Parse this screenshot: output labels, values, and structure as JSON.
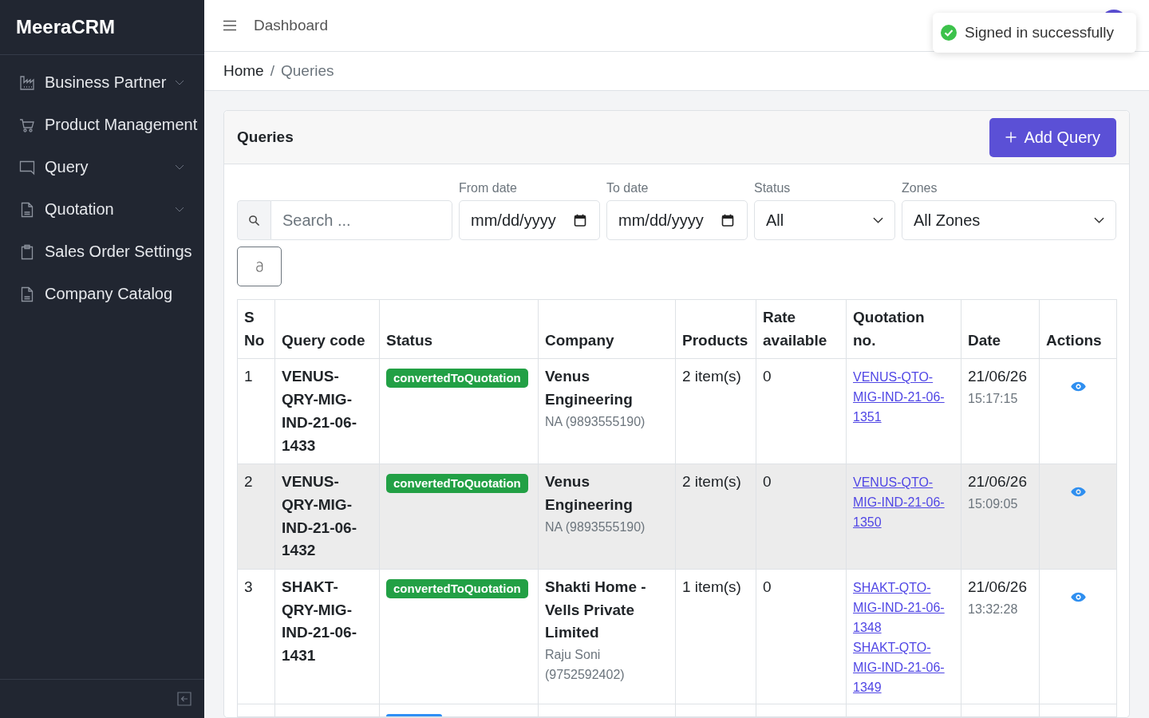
{
  "sidebar": {
    "brand": "MeeraCRM",
    "items": [
      {
        "label": "Business Partner",
        "submenu": true
      },
      {
        "label": "Product Management",
        "submenu": false
      },
      {
        "label": "Query",
        "submenu": true
      },
      {
        "label": "Quotation",
        "submenu": true
      },
      {
        "label": "Sales Order Settings",
        "submenu": false
      },
      {
        "label": "Company Catalog",
        "submenu": false
      }
    ]
  },
  "topbar": {
    "title": "Dashboard"
  },
  "toast": {
    "kind": "success",
    "message": "Signed in successfully"
  },
  "breadcrumb": {
    "items": [
      {
        "label": "Home",
        "current": false
      },
      {
        "label": "Queries",
        "current": true
      }
    ],
    "separator": "/"
  },
  "card": {
    "title": "Queries",
    "add_button": "Add Query"
  },
  "filters": {
    "search": {
      "placeholder": "Search ..."
    },
    "from_date": {
      "label": "From date",
      "placeholder": "mm/dd/yyyy"
    },
    "to_date": {
      "label": "To date",
      "placeholder": "mm/dd/yyyy"
    },
    "status": {
      "label": "Status",
      "value": "All"
    },
    "zones": {
      "label": "Zones",
      "value": "All Zones"
    }
  },
  "table": {
    "columns": [
      "S No",
      "Query code",
      "Status",
      "Company",
      "Products",
      "Rate available",
      "Quotation no.",
      "Date",
      "Actions"
    ],
    "rows": [
      {
        "kind": "full",
        "highlighted": false,
        "sno": "1",
        "query_code": "VENUS-QRY-MIG-IND-21-06-1433",
        "status": {
          "label": "convertedToQuotation",
          "color": "#22a045"
        },
        "company": "Venus Engineering",
        "contact": "NA (9893555190)",
        "products": "2 item(s)",
        "rate_available": "0",
        "quotations": [
          "VENUS-QTO-MIG-IND-21-06-1351"
        ],
        "date": "21/06/26",
        "time": "15:17:15"
      },
      {
        "kind": "full",
        "highlighted": true,
        "sno": "2",
        "query_code": "VENUS-QRY-MIG-IND-21-06-1432",
        "status": {
          "label": "convertedToQuotation",
          "color": "#22a045"
        },
        "company": "Venus Engineering",
        "contact": "NA (9893555190)",
        "products": "2 item(s)",
        "rate_available": "0",
        "quotations": [
          "VENUS-QTO-MIG-IND-21-06-1350"
        ],
        "date": "21/06/26",
        "time": "15:09:05"
      },
      {
        "kind": "full",
        "highlighted": false,
        "sno": "3",
        "query_code": "SHAKT-QRY-MIG-IND-21-06-1431",
        "status": {
          "label": "convertedToQuotation",
          "color": "#22a045"
        },
        "company": "Shakti Home - Vells Private Limited",
        "contact": "Raju Soni (9752592402)",
        "products": "1 item(s)",
        "rate_available": "0",
        "quotations": [
          "SHAKT-QTO-MIG-IND-21-06-1348",
          "SHAKT-QTO-MIG-IND-21-06-1349"
        ],
        "date": "21/06/26",
        "time": "13:32:28"
      },
      {
        "kind": "cut",
        "highlighted": false,
        "status": {
          "color": "#2f8ff5"
        }
      }
    ]
  }
}
